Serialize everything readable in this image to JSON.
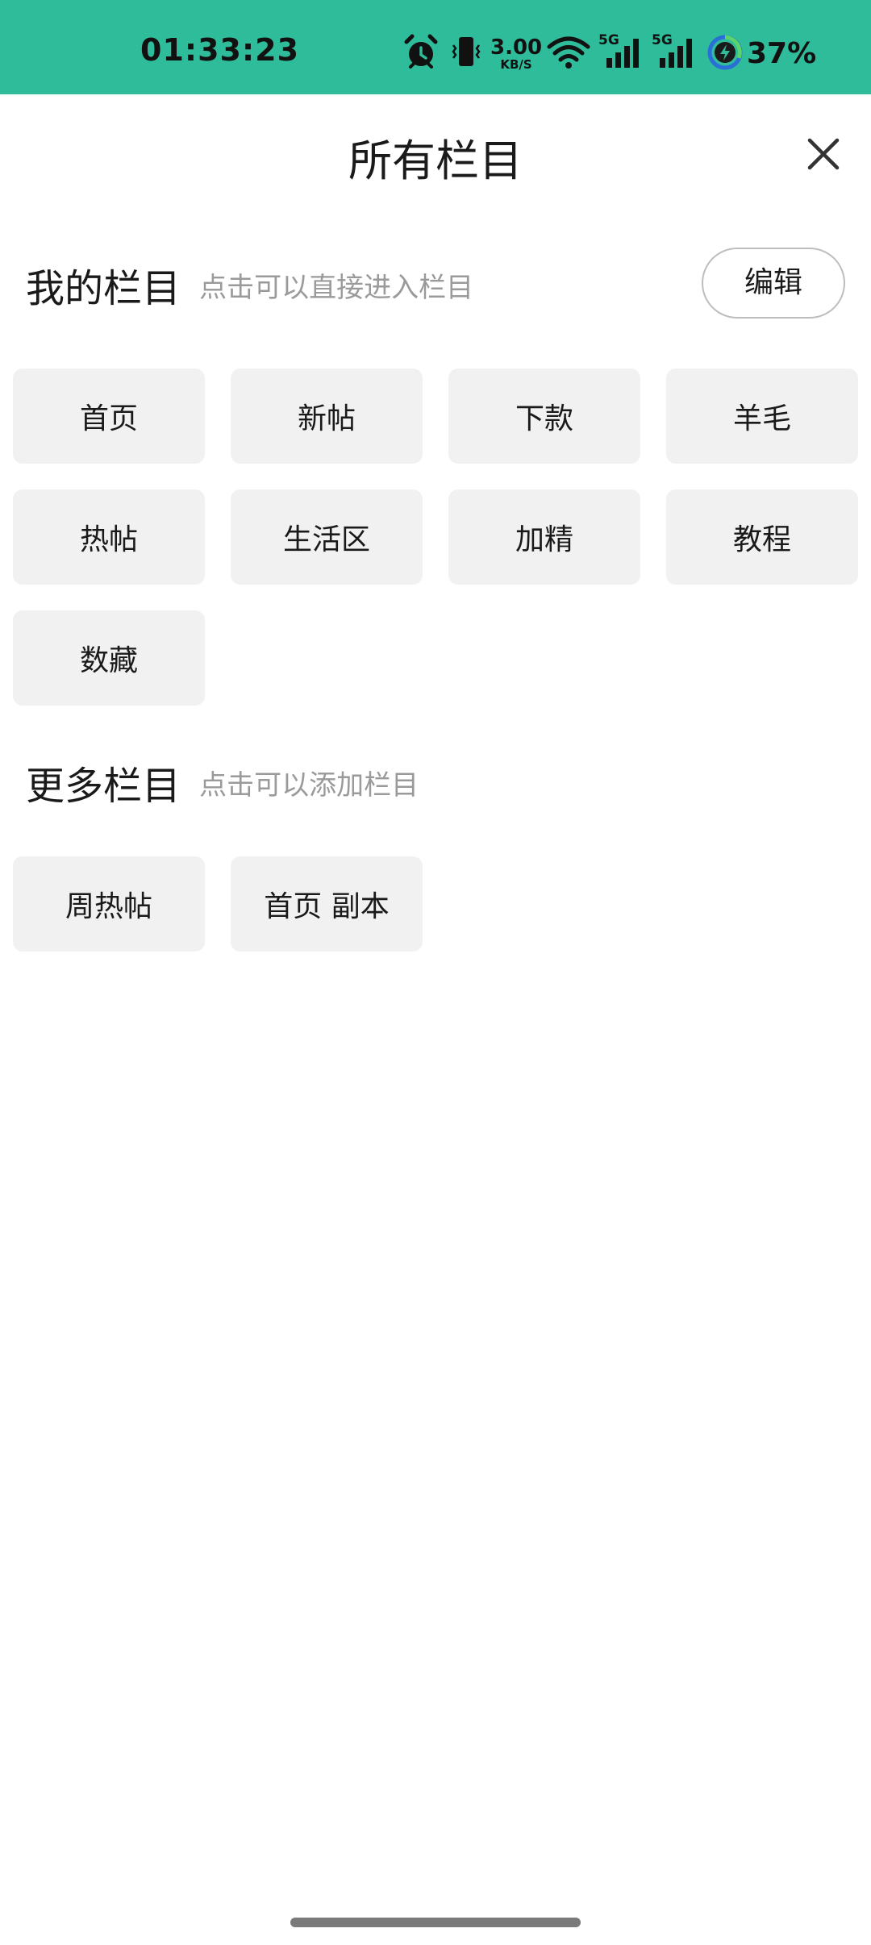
{
  "status_bar": {
    "time": "01:33:23",
    "network_speed_value": "3.00",
    "network_speed_unit": "KB/S",
    "signal_1_label": "5G",
    "signal_2_label": "5G",
    "battery_percent": "37%",
    "background_color": "#2fbc9a",
    "icons": [
      "alarm-icon",
      "vibrate-icon",
      "wifi-icon",
      "signal-icon",
      "signal-icon",
      "battery-charging-icon"
    ]
  },
  "header": {
    "title": "所有栏目",
    "close_icon": "close-icon"
  },
  "my_columns": {
    "title": "我的栏目",
    "hint": "点击可以直接进入栏目",
    "edit_label": "编辑",
    "items": [
      "首页",
      "新帖",
      "下款",
      "羊毛",
      "热帖",
      "生活区",
      "加精",
      "教程",
      "数藏"
    ]
  },
  "more_columns": {
    "title": "更多栏目",
    "hint": "点击可以添加栏目",
    "items": [
      "周热帖",
      "首页 副本"
    ]
  }
}
